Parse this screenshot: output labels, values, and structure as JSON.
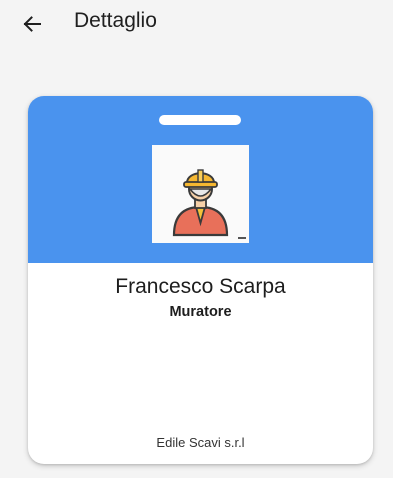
{
  "appbar": {
    "title": "Dettaglio",
    "back_icon": "arrow-left-icon"
  },
  "badge": {
    "header_color": "#4a93ee",
    "photo_icon": "construction-worker-icon",
    "name": "Francesco Scarpa",
    "role": "Muratore",
    "company": "Edile Scavi s.r.l"
  }
}
